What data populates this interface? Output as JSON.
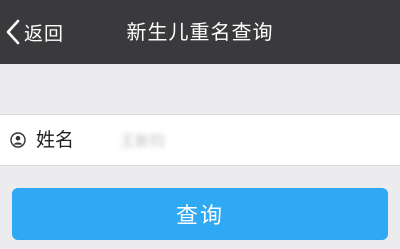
{
  "navbar": {
    "back_label": "返回",
    "back_icon": "chevron-left-icon",
    "title": "新生儿重名查询",
    "background": "#3a3a3c"
  },
  "form": {
    "name_label": "姓名",
    "name_icon": "user-circle-icon",
    "name_value": "王新钧"
  },
  "submit": {
    "label": "查询",
    "color": "#2fa9f3"
  }
}
